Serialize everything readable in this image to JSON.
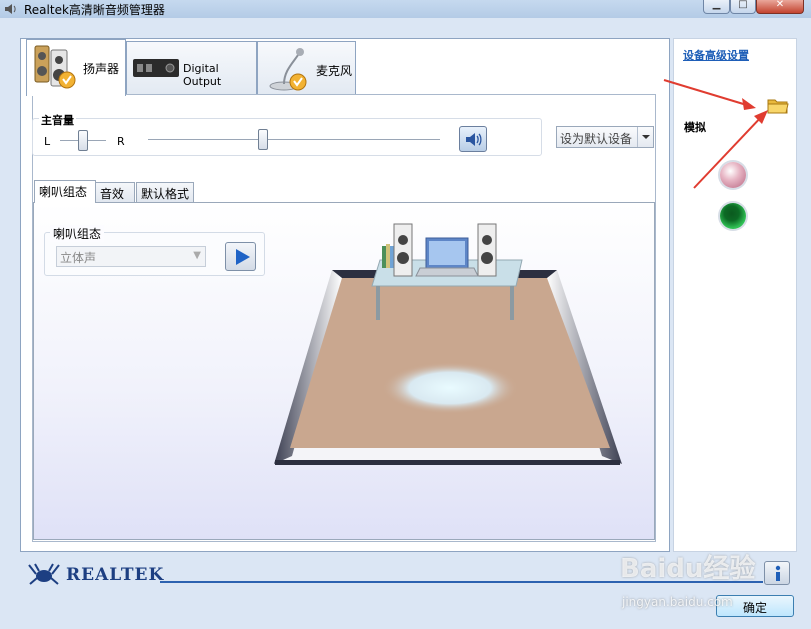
{
  "window": {
    "title": "Realtek高清晰音频管理器"
  },
  "device_tabs": [
    {
      "label": "扬声器",
      "active": true
    },
    {
      "label": "Digital Output",
      "active": false
    },
    {
      "label": "麦克风",
      "active": false
    }
  ],
  "master_volume": {
    "title": "主音量",
    "left_label": "L",
    "right_label": "R",
    "balance_percent": 50,
    "volume_percent": 39
  },
  "set_default_device": "设为默认设备",
  "sub_tabs": [
    {
      "label": "喇叭组态",
      "active": true
    },
    {
      "label": "音效",
      "active": false
    },
    {
      "label": "默认格式",
      "active": false
    }
  ],
  "speaker_config": {
    "group_title": "喇叭组态",
    "selected": "立体声"
  },
  "sidebar": {
    "advanced_link": "设备高级设置",
    "analog_label": "模拟"
  },
  "footer": {
    "brand": "REALTEK",
    "ok_label": "确定"
  },
  "watermark": {
    "main": "Baidu经验",
    "sub": "jingyan.baidu.com"
  },
  "colors": {
    "link": "#1f5fb8",
    "accent_line": "#2c62b0",
    "jack_pink": "#d98aa3",
    "jack_green": "#1a9a3a"
  }
}
